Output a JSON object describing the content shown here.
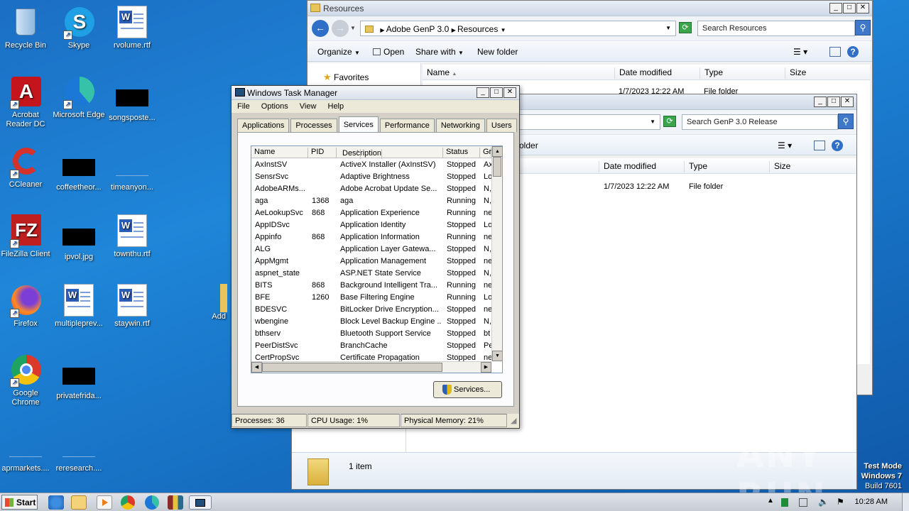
{
  "desktop": {
    "icons": [
      {
        "label": "Recycle Bin"
      },
      {
        "label": "Skype"
      },
      {
        "label": "rvolume.rtf"
      },
      {
        "label": "Acrobat Reader DC"
      },
      {
        "label": "Microsoft Edge"
      },
      {
        "label": "songsposte..."
      },
      {
        "label": "CCleaner"
      },
      {
        "label": "coffeetheor..."
      },
      {
        "label": "timeanyon..."
      },
      {
        "label": "FileZilla Client"
      },
      {
        "label": "ipvol.jpg"
      },
      {
        "label": "townthu.rtf"
      },
      {
        "label": "Firefox"
      },
      {
        "label": "multipleprev..."
      },
      {
        "label": "staywin.rtf"
      },
      {
        "label": "Google Chrome"
      },
      {
        "label": "privatefrida..."
      },
      {
        "label": "aprmarkets...."
      },
      {
        "label": "reresearch...."
      },
      {
        "label": "Add"
      }
    ],
    "watermark": {
      "line1": "Test Mode",
      "line2": "Windows 7",
      "line3": "Build 7601"
    },
    "brand": "ANY RUN"
  },
  "explorer1": {
    "title": "Resources",
    "breadcrumb": [
      "Adobe GenP 3.0",
      "Resources"
    ],
    "search_placeholder": "Search Resources",
    "commands": {
      "organize": "Organize",
      "open": "Open",
      "share": "Share with",
      "new_folder": "New folder"
    },
    "nav": {
      "favorites": "Favorites"
    },
    "columns": {
      "name": "Name",
      "date": "Date modified",
      "type": "Type",
      "size": "Size"
    },
    "rows": [
      {
        "date": "1/7/2023 12:22 AM",
        "type": "File folder"
      }
    ]
  },
  "explorer2": {
    "search_placeholder": "Search GenP 3.0 Release",
    "commands": {
      "new_folder_partial": "older"
    },
    "columns": {
      "date": "Date modified",
      "type": "Type",
      "size": "Size"
    },
    "rows": [
      {
        "date": "1/7/2023 12:22 AM",
        "type": "File folder"
      }
    ],
    "status": "1 item"
  },
  "taskmgr": {
    "title": "Windows Task Manager",
    "menu": [
      "File",
      "Options",
      "View",
      "Help"
    ],
    "tabs": [
      "Applications",
      "Processes",
      "Services",
      "Performance",
      "Networking",
      "Users"
    ],
    "active_tab": "Services",
    "columns": {
      "name": "Name",
      "pid": "PID",
      "description": "Description",
      "status": "Status",
      "group": "Gr"
    },
    "services": [
      {
        "name": "AxInstSV",
        "pid": "",
        "description": "ActiveX Installer (AxInstSV)",
        "status": "Stopped",
        "group": "Ax"
      },
      {
        "name": "SensrSvc",
        "pid": "",
        "description": "Adaptive Brightness",
        "status": "Stopped",
        "group": "Lo"
      },
      {
        "name": "AdobeARMs...",
        "pid": "",
        "description": "Adobe Acrobat Update Se...",
        "status": "Stopped",
        "group": "N,"
      },
      {
        "name": "aga",
        "pid": "1368",
        "description": "aga",
        "status": "Running",
        "group": "N,"
      },
      {
        "name": "AeLookupSvc",
        "pid": "868",
        "description": "Application Experience",
        "status": "Running",
        "group": "ne"
      },
      {
        "name": "AppIDSvc",
        "pid": "",
        "description": "Application Identity",
        "status": "Stopped",
        "group": "Lo"
      },
      {
        "name": "Appinfo",
        "pid": "868",
        "description": "Application Information",
        "status": "Running",
        "group": "ne"
      },
      {
        "name": "ALG",
        "pid": "",
        "description": "Application Layer Gatewa...",
        "status": "Stopped",
        "group": "N,"
      },
      {
        "name": "AppMgmt",
        "pid": "",
        "description": "Application Management",
        "status": "Stopped",
        "group": "ne"
      },
      {
        "name": "aspnet_state",
        "pid": "",
        "description": "ASP.NET State Service",
        "status": "Stopped",
        "group": "N,"
      },
      {
        "name": "BITS",
        "pid": "868",
        "description": "Background Intelligent Tra...",
        "status": "Running",
        "group": "ne"
      },
      {
        "name": "BFE",
        "pid": "1260",
        "description": "Base Filtering Engine",
        "status": "Running",
        "group": "Lo"
      },
      {
        "name": "BDESVC",
        "pid": "",
        "description": "BitLocker Drive Encryption...",
        "status": "Stopped",
        "group": "ne"
      },
      {
        "name": "wbengine",
        "pid": "",
        "description": "Block Level Backup Engine ...",
        "status": "Stopped",
        "group": "N,"
      },
      {
        "name": "bthserv",
        "pid": "",
        "description": "Bluetooth Support Service",
        "status": "Stopped",
        "group": "bt"
      },
      {
        "name": "PeerDistSvc",
        "pid": "",
        "description": "BranchCache",
        "status": "Stopped",
        "group": "Pe"
      },
      {
        "name": "CertPropSvc",
        "pid": "",
        "description": "Certificate Propagation",
        "status": "Stopped",
        "group": "ne"
      }
    ],
    "services_button": "Services...",
    "status": {
      "processes": "Processes: 36",
      "cpu": "CPU Usage: 1%",
      "memory": "Physical Memory: 21%"
    }
  },
  "taskbar": {
    "start": "Start",
    "clock": "10:28 AM"
  }
}
